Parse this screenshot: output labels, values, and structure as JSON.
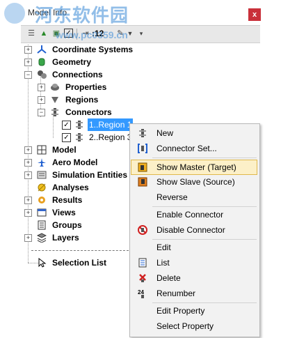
{
  "window": {
    "title": "Model Info",
    "close": "x"
  },
  "watermark": {
    "text": "河东软件园",
    "url": "www.pc0359.cn"
  },
  "toolbar": {
    "counter": ":12"
  },
  "tree": {
    "items": [
      {
        "label": "Coordinate Systems"
      },
      {
        "label": "Geometry"
      },
      {
        "label": "Connections"
      },
      {
        "label": "Properties"
      },
      {
        "label": "Regions"
      },
      {
        "label": "Connectors"
      },
      {
        "label": "1..Region 1"
      },
      {
        "label": "2..Region 3"
      },
      {
        "label": "Model"
      },
      {
        "label": "Aero Model"
      },
      {
        "label": "Simulation Entities"
      },
      {
        "label": "Analyses"
      },
      {
        "label": "Results"
      },
      {
        "label": "Views"
      },
      {
        "label": "Groups"
      },
      {
        "label": "Layers"
      },
      {
        "label": "Selection List"
      }
    ]
  },
  "context_menu": {
    "items": [
      {
        "label": "New"
      },
      {
        "label": "Connector Set..."
      },
      {
        "label": "Show Master (Target)"
      },
      {
        "label": "Show Slave (Source)"
      },
      {
        "label": "Reverse"
      },
      {
        "label": "Enable Connector"
      },
      {
        "label": "Disable Connector"
      },
      {
        "label": "Edit"
      },
      {
        "label": "List"
      },
      {
        "label": "Delete"
      },
      {
        "label": "Renumber"
      },
      {
        "label": "Edit Property"
      },
      {
        "label": "Select Property"
      }
    ]
  },
  "colors": {
    "selection": "#3399ff",
    "highlight": "#fcf0c8",
    "close": "#c9303a",
    "toolbar": "#e8e8e8"
  }
}
